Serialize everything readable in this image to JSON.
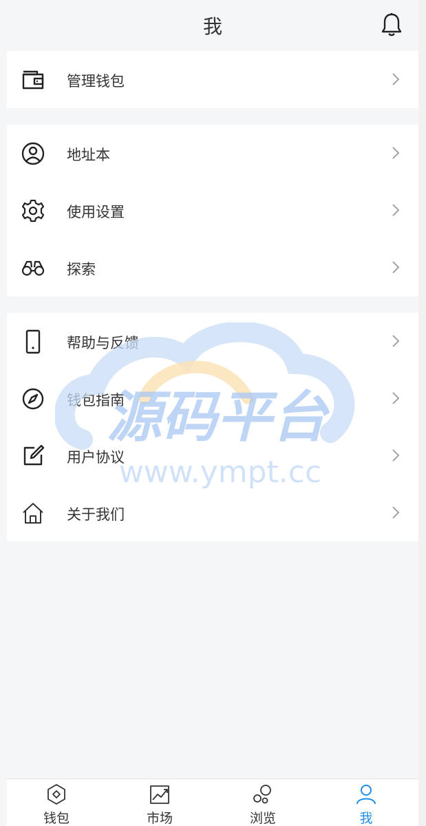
{
  "header": {
    "title": "我",
    "bell_icon": "bell-icon"
  },
  "groups": [
    {
      "items": [
        {
          "icon": "wallet-icon",
          "label": "管理钱包"
        }
      ]
    },
    {
      "items": [
        {
          "icon": "user-circle-icon",
          "label": "地址本"
        },
        {
          "icon": "gear-icon",
          "label": "使用设置"
        },
        {
          "icon": "binoculars-icon",
          "label": "探索"
        }
      ]
    },
    {
      "items": [
        {
          "icon": "phone-icon",
          "label": "帮助与反馈"
        },
        {
          "icon": "compass-icon",
          "label": "钱包指南"
        },
        {
          "icon": "edit-icon",
          "label": "用户协议"
        },
        {
          "icon": "home-icon",
          "label": "关于我们"
        }
      ]
    }
  ],
  "watermark": {
    "title": "源码平台",
    "url": "www.ympt.cc"
  },
  "tabbar": {
    "active": "我",
    "accent": "#1f8ee8",
    "tabs": [
      {
        "icon": "wallet-hex-icon",
        "label": "钱包"
      },
      {
        "icon": "chart-icon",
        "label": "市场"
      },
      {
        "icon": "bubbles-icon",
        "label": "浏览"
      },
      {
        "icon": "person-icon",
        "label": "我"
      }
    ]
  }
}
